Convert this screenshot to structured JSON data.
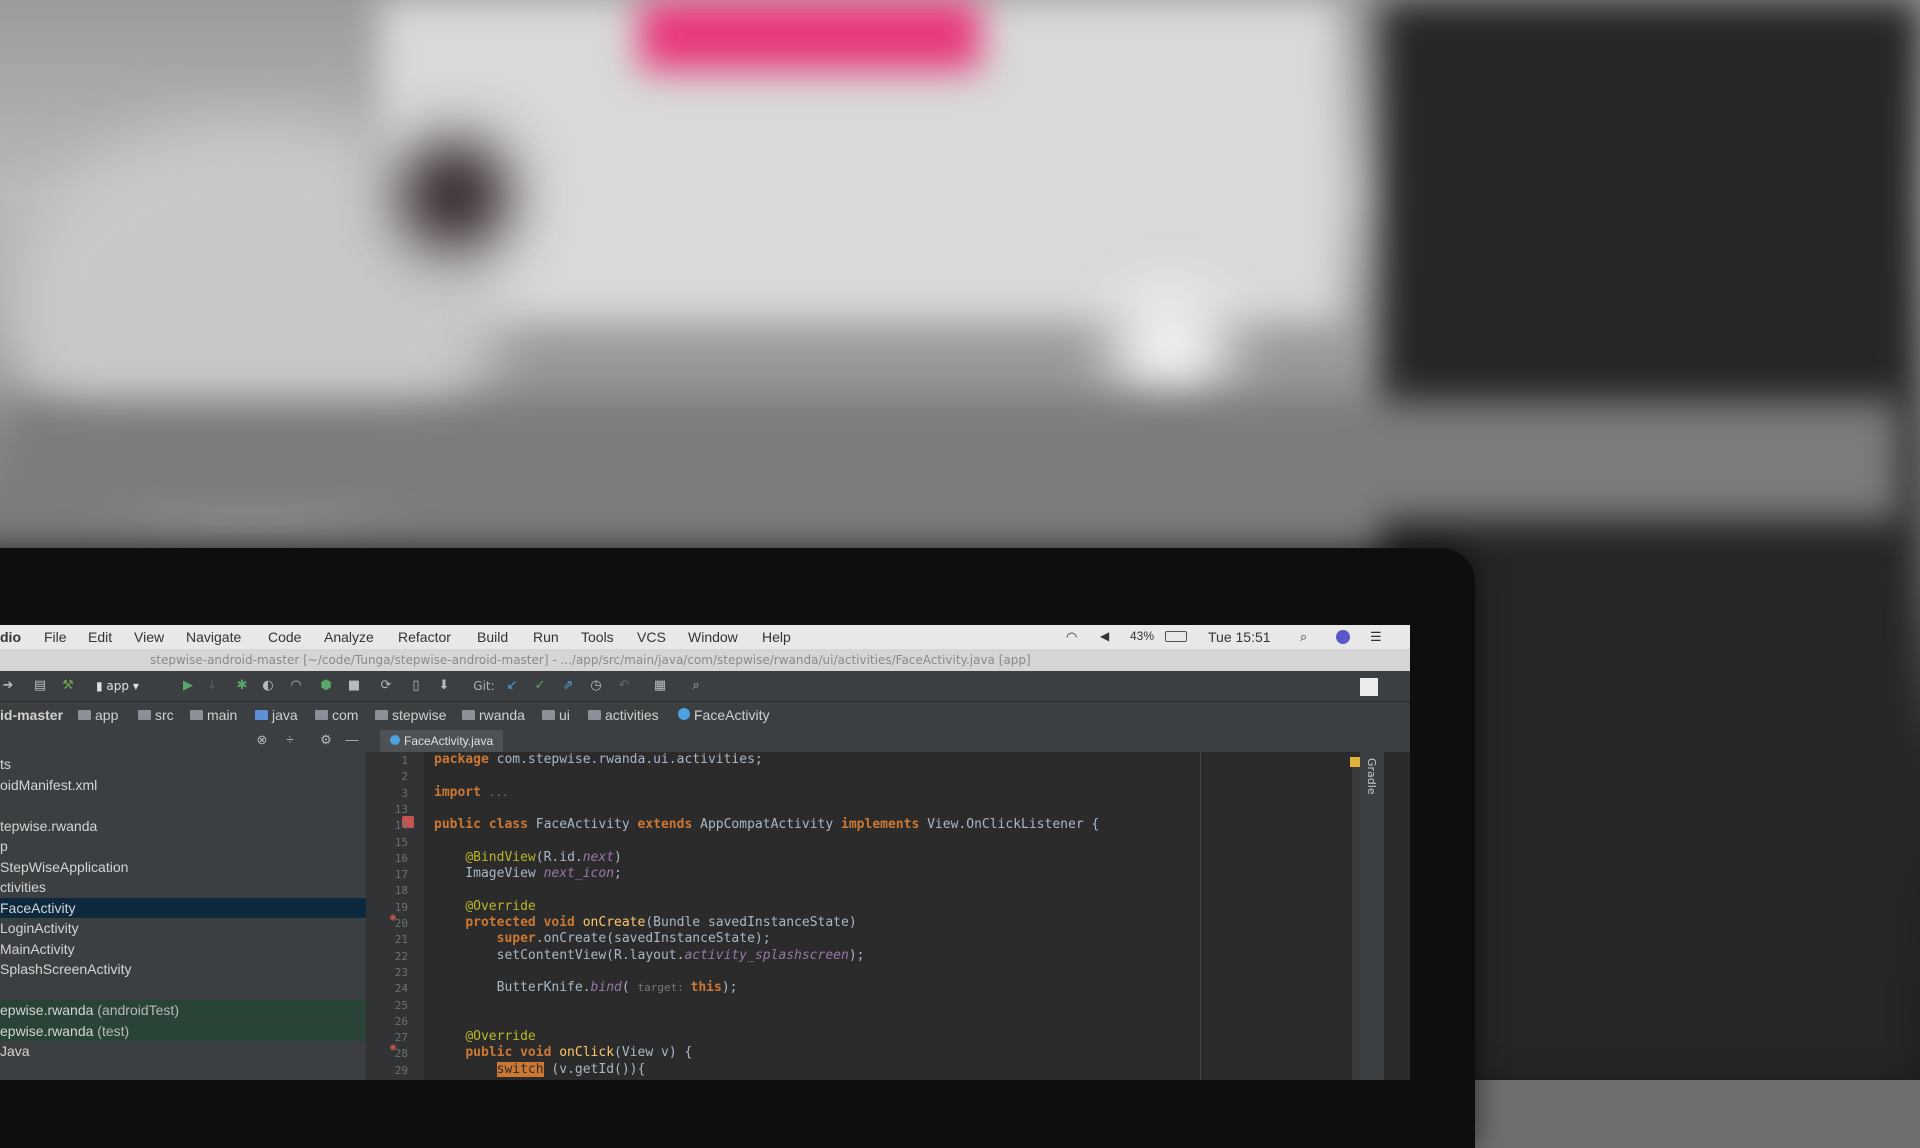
{
  "menubar": {
    "app_name": "dio",
    "items": [
      "File",
      "Edit",
      "View",
      "Navigate",
      "Code",
      "Analyze",
      "Refactor",
      "Build",
      "Run",
      "Tools",
      "VCS",
      "Window",
      "Help"
    ],
    "battery": "43%",
    "clock": "Tue 15:51"
  },
  "titlebar": {
    "path": "stepwise-android-master [~/code/Tunga/stepwise-android-master] - .../app/src/main/java/com/stepwise/rwanda/ui/activities/FaceActivity.java [app]"
  },
  "toolbar": {
    "run_config": "app",
    "git_label": "Git:"
  },
  "breadcrumbs": [
    "id-master",
    "app",
    "src",
    "main",
    "java",
    "com",
    "stepwise",
    "rwanda",
    "ui",
    "activities",
    "FaceActivity"
  ],
  "project_tree": [
    {
      "label": "ts",
      "state": "normal"
    },
    {
      "label": "oidManifest.xml",
      "state": "normal"
    },
    {
      "label": "",
      "state": "normal"
    },
    {
      "label": "tepwise.rwanda",
      "state": "normal"
    },
    {
      "label": "p",
      "state": "normal"
    },
    {
      "label": "StepWiseApplication",
      "state": "normal"
    },
    {
      "label": "ctivities",
      "state": "normal"
    },
    {
      "label": "FaceActivity",
      "state": "selected"
    },
    {
      "label": "LoginActivity",
      "state": "normal"
    },
    {
      "label": "MainActivity",
      "state": "normal"
    },
    {
      "label": "SplashScreenActivity",
      "state": "normal"
    },
    {
      "label": "",
      "state": "normal"
    },
    {
      "label": "epwise.rwanda",
      "suffix": "(androidTest)",
      "state": "test"
    },
    {
      "label": "epwise.rwanda",
      "suffix": "(test)",
      "state": "test"
    },
    {
      "label": "Java",
      "state": "normal"
    }
  ],
  "editor": {
    "tab_label": "FaceActivity.java",
    "right_strip_label": "Gradle",
    "lines": [
      {
        "n": "1",
        "code": [
          {
            "t": "package ",
            "c": "kw"
          },
          {
            "t": "com.stepwise.rwanda.ui.activities;",
            "c": ""
          }
        ]
      },
      {
        "n": "2",
        "code": []
      },
      {
        "n": "3",
        "code": [
          {
            "t": "import ",
            "c": "kw"
          },
          {
            "t": "...",
            "c": "hint"
          }
        ]
      },
      {
        "n": "13",
        "code": []
      },
      {
        "n": "14",
        "code": [
          {
            "t": "public class ",
            "c": "kw"
          },
          {
            "t": "FaceActivity ",
            "c": ""
          },
          {
            "t": "extends ",
            "c": "kw"
          },
          {
            "t": "AppCompatActivity ",
            "c": ""
          },
          {
            "t": "implements ",
            "c": "kw"
          },
          {
            "t": "View.OnClickListener {",
            "c": ""
          }
        ]
      },
      {
        "n": "15",
        "code": []
      },
      {
        "n": "16",
        "code": [
          {
            "t": "    ",
            "c": ""
          },
          {
            "t": "@BindView",
            "c": "an"
          },
          {
            "t": "(R.id.",
            "c": ""
          },
          {
            "t": "next",
            "c": "it"
          },
          {
            "t": ")",
            "c": ""
          }
        ]
      },
      {
        "n": "17",
        "code": [
          {
            "t": "    ImageView ",
            "c": ""
          },
          {
            "t": "next_icon",
            "c": "it"
          },
          {
            "t": ";",
            "c": ""
          }
        ]
      },
      {
        "n": "18",
        "code": []
      },
      {
        "n": "19",
        "code": [
          {
            "t": "    ",
            "c": ""
          },
          {
            "t": "@Override",
            "c": "an"
          }
        ]
      },
      {
        "n": "20",
        "code": [
          {
            "t": "    ",
            "c": ""
          },
          {
            "t": "protected void ",
            "c": "kw"
          },
          {
            "t": "onCreate",
            "c": "fn"
          },
          {
            "t": "(Bundle savedInstanceState) ",
            "c": ""
          }
        ]
      },
      {
        "n": "21",
        "code": [
          {
            "t": "        ",
            "c": ""
          },
          {
            "t": "super",
            "c": "kw"
          },
          {
            "t": ".onCreate(savedInstanceState);",
            "c": ""
          }
        ]
      },
      {
        "n": "22",
        "code": [
          {
            "t": "        setContentView(R.layout.",
            "c": ""
          },
          {
            "t": "activity_splashscreen",
            "c": "it"
          },
          {
            "t": ");",
            "c": ""
          }
        ]
      },
      {
        "n": "23",
        "code": []
      },
      {
        "n": "24",
        "code": [
          {
            "t": "        ButterKnife.",
            "c": ""
          },
          {
            "t": "bind",
            "c": "it"
          },
          {
            "t": "( ",
            "c": ""
          },
          {
            "t": "target: ",
            "c": "hint"
          },
          {
            "t": "this",
            "c": "kw"
          },
          {
            "t": ");",
            "c": ""
          }
        ]
      },
      {
        "n": "25",
        "code": []
      },
      {
        "n": "26",
        "code": []
      },
      {
        "n": "27",
        "code": [
          {
            "t": "    ",
            "c": ""
          },
          {
            "t": "@Override",
            "c": "an"
          }
        ]
      },
      {
        "n": "28",
        "code": [
          {
            "t": "    ",
            "c": ""
          },
          {
            "t": "public void ",
            "c": "kw"
          },
          {
            "t": "onClick",
            "c": "fn"
          },
          {
            "t": "(View v) {",
            "c": ""
          }
        ]
      },
      {
        "n": "29",
        "code": [
          {
            "t": "        ",
            "c": ""
          },
          {
            "t": "switch",
            "c": "sw"
          },
          {
            "t": " (v.getId()){",
            "c": ""
          }
        ]
      }
    ]
  },
  "colors": {
    "selection": "#0d293e",
    "test_root": "#294436",
    "keyword": "#cc7832",
    "annotation": "#bbb529"
  }
}
